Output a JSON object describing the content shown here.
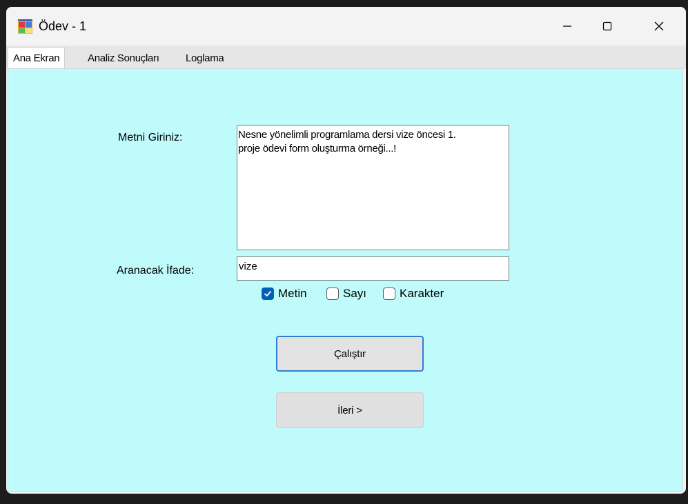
{
  "window": {
    "title": "Ödev - 1",
    "minimize_glyph": "—",
    "maximize_glyph": "☐",
    "close_glyph": "✕"
  },
  "tabs": [
    {
      "label": "Ana Ekran",
      "active": true
    },
    {
      "label": "Analiz Sonuçları",
      "active": false
    },
    {
      "label": "Loglama",
      "active": false
    }
  ],
  "form": {
    "text_label": "Metni Giriniz:",
    "text_value": "Nesne yönelimli programlama dersi vize öncesi 1.\nproje ödevi form oluşturma örneği...!",
    "search_label": "Aranacak İfade:",
    "search_value": "vize",
    "checkboxes": [
      {
        "label": "Metin",
        "checked": true
      },
      {
        "label": "Sayı",
        "checked": false
      },
      {
        "label": "Karakter",
        "checked": false
      }
    ],
    "run_button": "Çalıştır",
    "next_button": "İleri >"
  },
  "colors": {
    "panel_background": "#c0fbfb",
    "accent": "#005fb8"
  }
}
